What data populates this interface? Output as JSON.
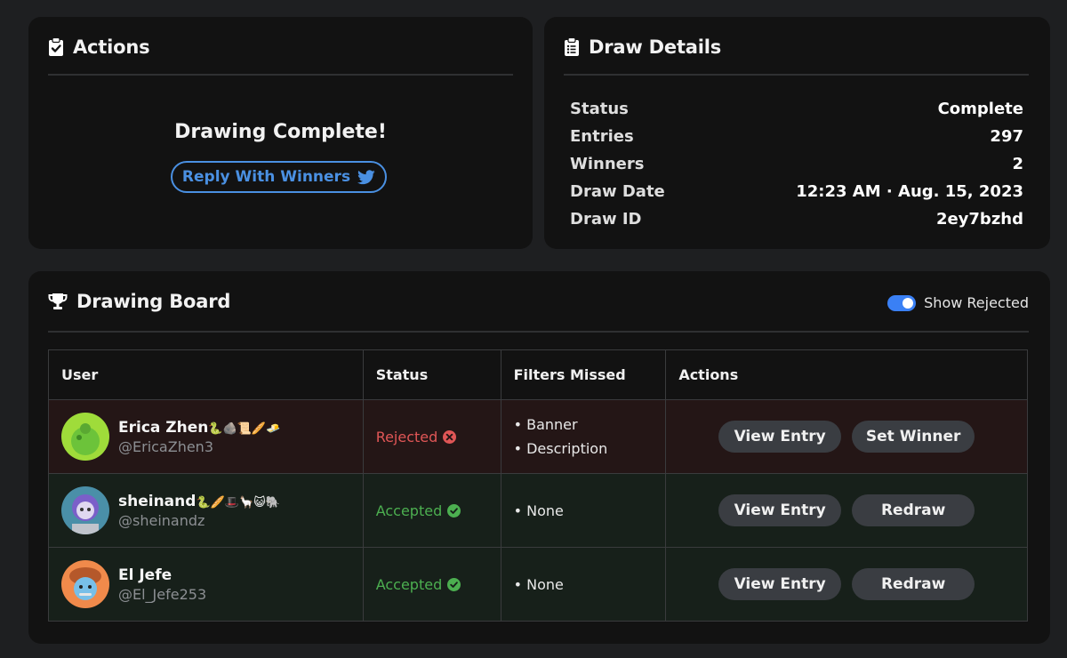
{
  "actions": {
    "title": "Actions",
    "status_message": "Drawing Complete!",
    "reply_button_label": "Reply With Winners"
  },
  "details": {
    "title": "Draw Details",
    "rows": [
      {
        "key": "Status",
        "value": "Complete"
      },
      {
        "key": "Entries",
        "value": "297"
      },
      {
        "key": "Winners",
        "value": "2"
      },
      {
        "key": "Draw Date",
        "value": "12:23 AM · Aug. 15, 2023"
      },
      {
        "key": "Draw ID",
        "value": "2ey7bzhd"
      }
    ]
  },
  "board": {
    "title": "Drawing Board",
    "toggle_label": "Show Rejected",
    "toggle_on": true,
    "columns": [
      "User",
      "Status",
      "Filters Missed",
      "Actions"
    ],
    "rows": [
      {
        "name": "Erica Zhen",
        "emojis": "🐍🪨📜🥖🧈",
        "handle": "@EricaZhen3",
        "status": "Rejected",
        "filters": [
          "Banner",
          "Description"
        ],
        "primary_action": "View Entry",
        "secondary_action": "Set Winner"
      },
      {
        "name": "sheinand",
        "emojis": "🐍🥖🎩🦙😺🐘",
        "handle": "@sheinandz",
        "status": "Accepted",
        "filters": [
          "None"
        ],
        "primary_action": "View Entry",
        "secondary_action": "Redraw"
      },
      {
        "name": "El Jefe",
        "emojis": "",
        "handle": "@El_Jefe253",
        "status": "Accepted",
        "filters": [
          "None"
        ],
        "primary_action": "View Entry",
        "secondary_action": "Redraw"
      }
    ]
  },
  "colors": {
    "background": "#1e1f21",
    "card": "#121212",
    "accent_blue": "#4a90e2",
    "rejected": "#e05656",
    "accepted": "#4caf50"
  },
  "icons": {
    "actions": "clipboard-check-icon",
    "details": "clipboard-list-icon",
    "board": "trophy-icon",
    "reply": "twitter-icon",
    "rejected": "x-circle-icon",
    "accepted": "check-circle-icon"
  }
}
